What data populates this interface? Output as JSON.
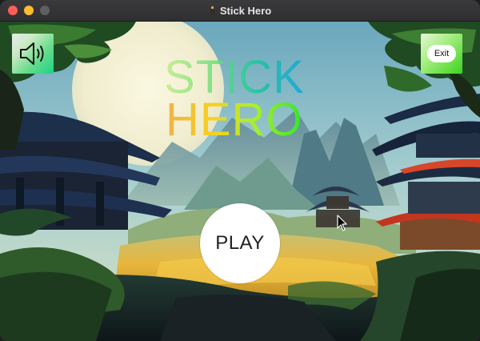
{
  "window": {
    "title": "Stick Hero",
    "traffic_lights": [
      "close",
      "minimize",
      "zoom"
    ]
  },
  "menu": {
    "logo_line1": "STICK",
    "logo_line2": "HERO",
    "play_label": "PLAY",
    "exit_label": "Exit",
    "sound_icon": "speaker-on-icon"
  },
  "colors": {
    "sky_top": "#7fb7c9",
    "sun": "#f2f1d6",
    "pagoda_roof": "#1f3553",
    "lantern_red": "#d94a2a",
    "path_gold": "#e8b83c",
    "foliage": "#2f6a2a"
  }
}
